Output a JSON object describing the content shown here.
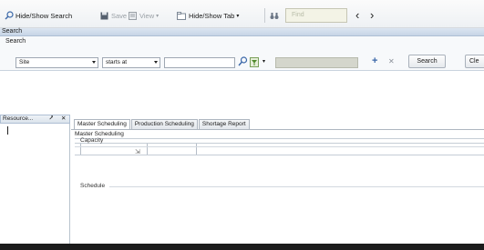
{
  "toolbar": {
    "hide_show_search": "Hide/Show Search",
    "save": "Save",
    "view": "View",
    "hide_show_tab": "Hide/Show Tab",
    "find_placeholder": "Find"
  },
  "search_panel": {
    "header": "Search",
    "subheader": "Search",
    "field_select": "Site",
    "operator_select": "starts at",
    "value_input": "",
    "search_button": "Search",
    "clear_button": "Cle"
  },
  "resource_pane": {
    "title": "Resource..."
  },
  "tabs": [
    {
      "label": "Master Scheduling",
      "active": true
    },
    {
      "label": "Production Scheduling",
      "active": false
    },
    {
      "label": "Shortage Report",
      "active": false
    }
  ],
  "master_scheduling": {
    "title": "Master Scheduling",
    "sections": {
      "capacity": "Capacity",
      "schedule": "Schedule"
    }
  },
  "colors": {
    "header_blue": "#c7d5e6",
    "find_box": "#f3f3e6",
    "grey_box": "#d4d6cc"
  }
}
